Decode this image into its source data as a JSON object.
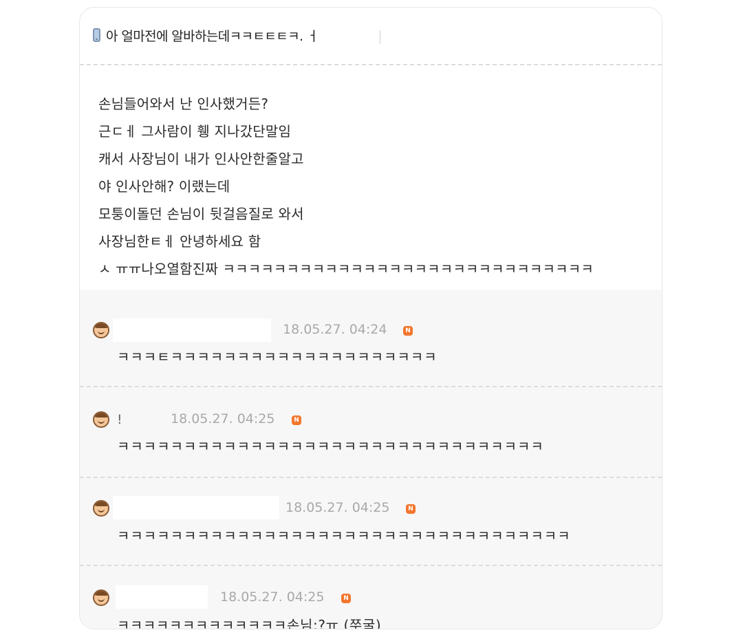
{
  "post": {
    "title": "아 얼마전에 알바하는데ㅋㅋㅌㅌㅌㅋ. ㅓ",
    "lines": [
      "손님들어와서 난 인사했거든?",
      "근ㄷㅔ 그사람이 휑 지나갔단말임",
      "캐서 사장님이 내가 인사안한줄알고",
      "야 인사안해? 이랬는데",
      "모퉁이돌던 손님이 뒷걸음질로 와서",
      "사장님한ㅌㅔ 안녕하세요 함",
      "ㅅ ㅠㅠ나오열함진짜 ㅋㅋㅋㅋㅋㅋㅋㅋㅋㅋㅋㅋㅋㅋㅋㅋㅋㅋㅋㅋㅋㅋㅋㅋㅋㅋㅋㅋㅋ"
    ]
  },
  "comments": [
    {
      "name": "",
      "timestamp": "18.05.27. 04:24",
      "badge": "N",
      "text": "ㅋㅋㅋㅌㅋㅋㅋㅋㅋㅋㅋㅋㅋㅋㅋㅋㅋㅋㅋㅋㅋㅋㅋㅋ"
    },
    {
      "name": "!",
      "timestamp": "18.05.27. 04:25",
      "badge": "N",
      "text": "ㅋㅋㅋㅋㅋㅋㅋㅋㅋㅋㅋㅋㅋㅋㅋㅋㅋㅋㅋㅋㅋㅋㅋㅋㅋㅋㅋㅋㅋㅋㅋㅋ"
    },
    {
      "name": "",
      "timestamp": "18.05.27. 04:25",
      "badge": "N",
      "text": "ㅋㅋㅋㅋㅋㅋㅋㅋㅋㅋㅋㅋㅋㅋㅋㅋㅋㅋㅋㅋㅋㅋㅋㅋㅋㅋㅋㅋㅋㅋㅋㅋㅋㅋ"
    },
    {
      "name": "",
      "timestamp": "18.05.27. 04:25",
      "badge": "N",
      "text": "ㅋㅋㅋㅋㅋㅋㅋㅋㅋㅋㅋㅋㅋ손님:?ㅠ (쭈굴)"
    }
  ],
  "colors": {
    "badge": "#f2772e",
    "timestamp": "#a8a8a8",
    "comments_bg": "#f7f7f7",
    "text": "#2b2b2b"
  },
  "icons": {
    "title": "phone-icon",
    "avatar": "avatar-icon",
    "badge": "n-badge-icon"
  }
}
